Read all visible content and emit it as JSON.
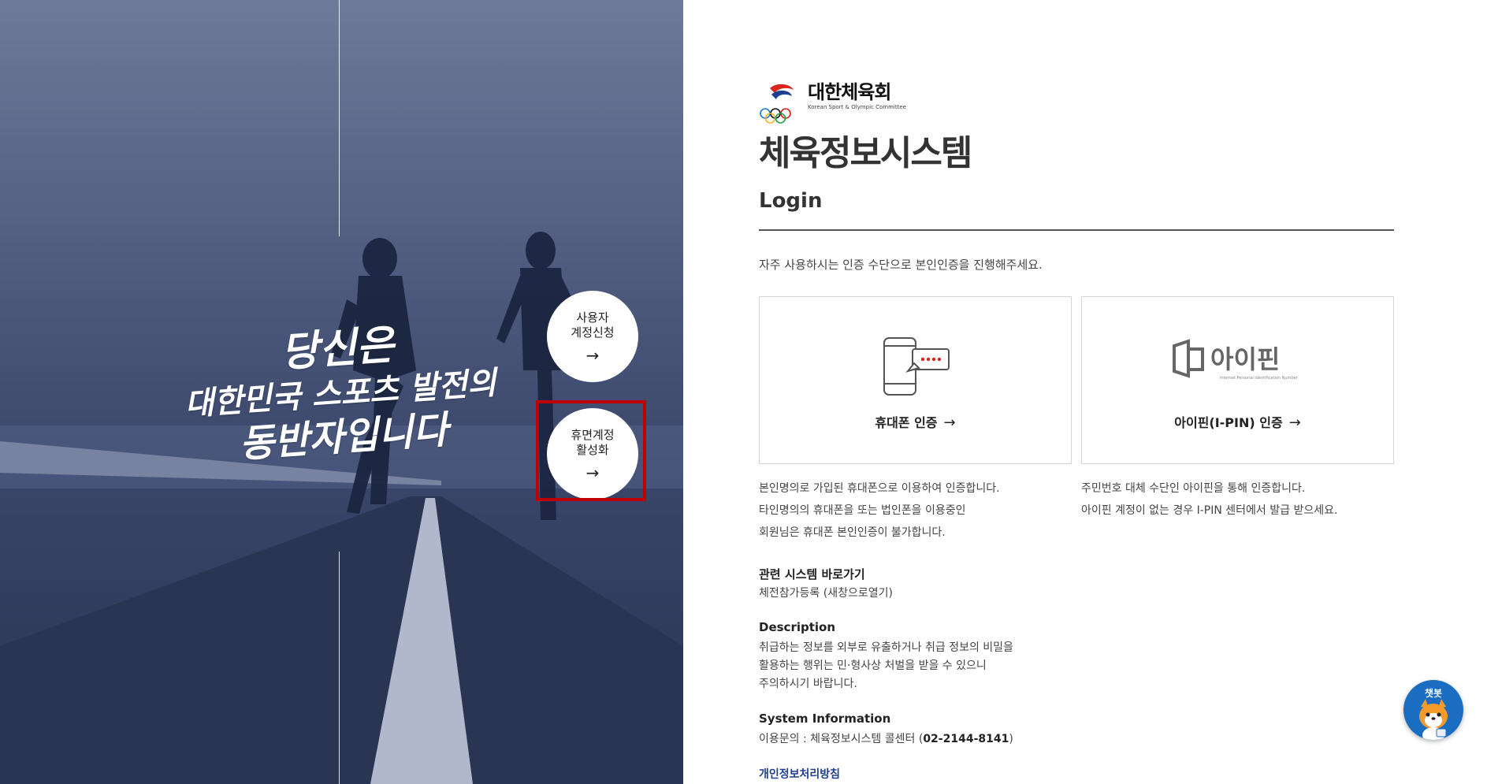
{
  "hero": {
    "slogan_line1": "당신은",
    "slogan_line2": "대한민국 스포츠 발전의",
    "slogan_line3": "동반자입니다",
    "signup_button": {
      "label": "사용자\n계정신청",
      "arrow": "→"
    },
    "dormant_button": {
      "label": "휴면계정\n활성화",
      "arrow": "→"
    }
  },
  "logo": {
    "name": "대한체육회",
    "subtitle": "Korean Sport & Olympic Committee"
  },
  "page": {
    "system_title": "체육정보시스템",
    "login_title": "Login",
    "intro": "자주 사용하시는 인증 수단으로 본인인증을 진행해주세요."
  },
  "auth": {
    "phone": {
      "label": "휴대폰 인증",
      "arrow": "→",
      "icon": "mobile-phone-message-icon",
      "desc": [
        "본인명의로 가입된 휴대폰으로 이용하여 인증합니다.",
        "타인명의의 휴대폰을 또는 법인폰을 이용중인",
        "회원님은 휴대폰 본인인증이 불가합니다."
      ]
    },
    "ipin": {
      "label": "아이핀(I-PIN) 인증",
      "arrow": "→",
      "icon": "ipin-logo-icon",
      "logo_text": "아이핀",
      "logo_sub": "Internet Personal Identification Number",
      "desc": [
        "주민번호 대체 수단인 아이핀을 통해 인증합니다.",
        "아이핀 계정이 없는 경우 I-PIN 센터에서 발급 받으세요."
      ]
    }
  },
  "related": {
    "heading": "관련 시스템 바로가기",
    "link": "체전참가등록 (새창으로열기)"
  },
  "description": {
    "heading": "Description",
    "lines": [
      "취급하는 정보를 외부로 유출하거나 취급 정보의 비밀을",
      "활용하는 행위는 민·형사상 처벌을 받을 수 있으니",
      "주의하시기 바랍니다."
    ]
  },
  "system_info": {
    "heading": "System Information",
    "prefix": "이용문의 : 체육정보시스템 콜센터 (",
    "phone": "02-2144-8141",
    "suffix": ")"
  },
  "privacy_link": "개인정보처리방침",
  "chatbot": {
    "label": "챗봇",
    "icon": "mascot-icon"
  },
  "colors": {
    "hero_overlay": "#39466a",
    "highlight": "#c00000",
    "privacy_link": "#1f3f8f",
    "chatbot_bg": "#1b6dc1"
  }
}
